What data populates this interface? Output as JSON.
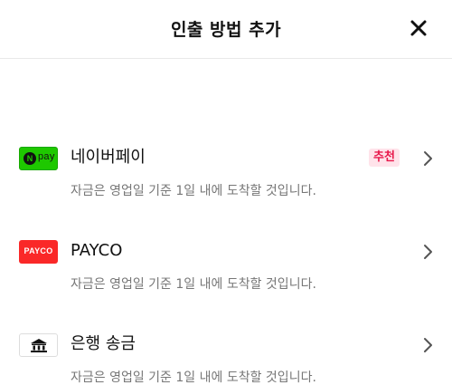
{
  "header": {
    "title": "인출 방법 추가",
    "close_icon": "close-icon"
  },
  "methods": [
    {
      "name": "네이버페이",
      "badge": "추천",
      "description": "자금은 영업일 기준 1일 내에 도착할 것입니다.",
      "logo": {
        "icon": "naver-pay-logo",
        "mark": "N",
        "text": "pay",
        "color": "#1ec800"
      }
    },
    {
      "name": "PAYCO",
      "description": "자금은 영업일 기준 1일 내에 도착할 것입니다.",
      "logo": {
        "icon": "payco-logo",
        "text": "PAYCO",
        "color": "#fa2828"
      }
    },
    {
      "name": "은행 송금",
      "description": "자금은 영업일 기준 1일 내에 도착할 것입니다.",
      "logo": {
        "icon": "bank-icon",
        "color": "#111111"
      }
    }
  ],
  "colors": {
    "badge_background": "#ffe3ea",
    "badge_text": "#e8174a",
    "description_text": "#777777",
    "divider": "#e9e9e9"
  }
}
